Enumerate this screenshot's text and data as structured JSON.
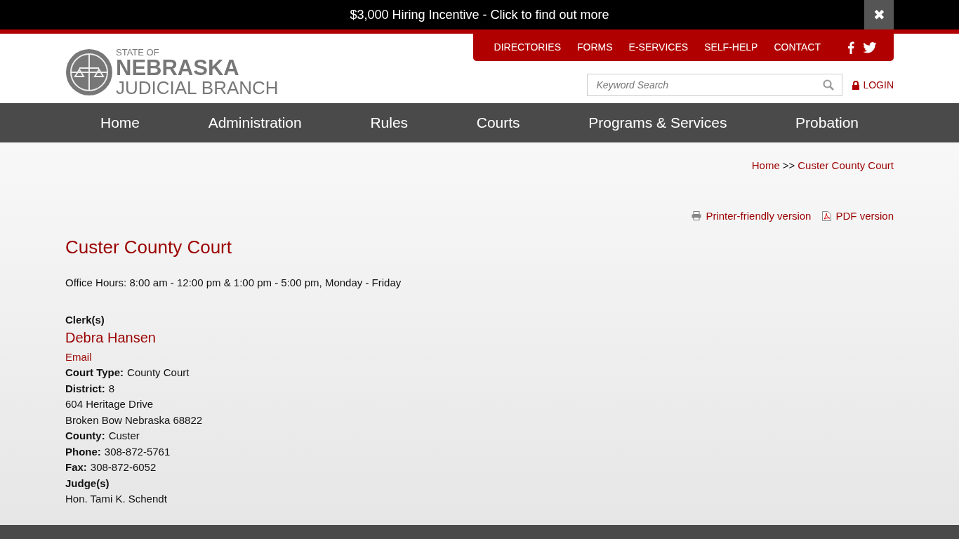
{
  "banner": {
    "text": "$3,000 Hiring Incentive - Click to find out more",
    "close": "✖"
  },
  "logo": {
    "line_1": "STATE OF",
    "line_2": "NEBRASKA",
    "line_3": "JUDICIAL BRANCH"
  },
  "utility_nav": [
    "DIRECTORIES",
    "FORMS",
    "E-SERVICES",
    "SELF-HELP",
    "CONTACT"
  ],
  "search": {
    "placeholder": "Keyword Search"
  },
  "login": "LOGIN",
  "main_nav": [
    "Home",
    "Administration",
    "Rules",
    "Courts",
    "Programs & Services",
    "Probation"
  ],
  "breadcrumb": {
    "home": "Home",
    "separator": ">>",
    "current": "Custer County Court"
  },
  "print_links": {
    "printer": "Printer-friendly version",
    "pdf": "PDF version"
  },
  "title": "Custer County Court",
  "office_hours": "Office Hours: 8:00 am - 12:00 pm & 1:00 pm - 5:00 pm, Monday - Friday",
  "clerk": {
    "heading": "Clerk(s)",
    "name": "Debra Hansen",
    "email": "Email"
  },
  "details": [
    {
      "kind": "field",
      "label": "Court Type:",
      "value": "County Court"
    },
    {
      "kind": "field",
      "label": "District:",
      "value": "8"
    },
    {
      "kind": "line",
      "text": "604 Heritage Drive"
    },
    {
      "kind": "line",
      "text": "Broken Bow Nebraska 68822"
    },
    {
      "kind": "field",
      "label": "County:",
      "value": "Custer"
    },
    {
      "kind": "field",
      "label": "Phone:",
      "value": "308-872-5761"
    },
    {
      "kind": "field",
      "label": "Fax:",
      "value": "308-872-6052"
    },
    {
      "kind": "heading",
      "text": "Judge(s)"
    },
    {
      "kind": "line",
      "text": "Hon. Tami K. Schendt"
    }
  ]
}
